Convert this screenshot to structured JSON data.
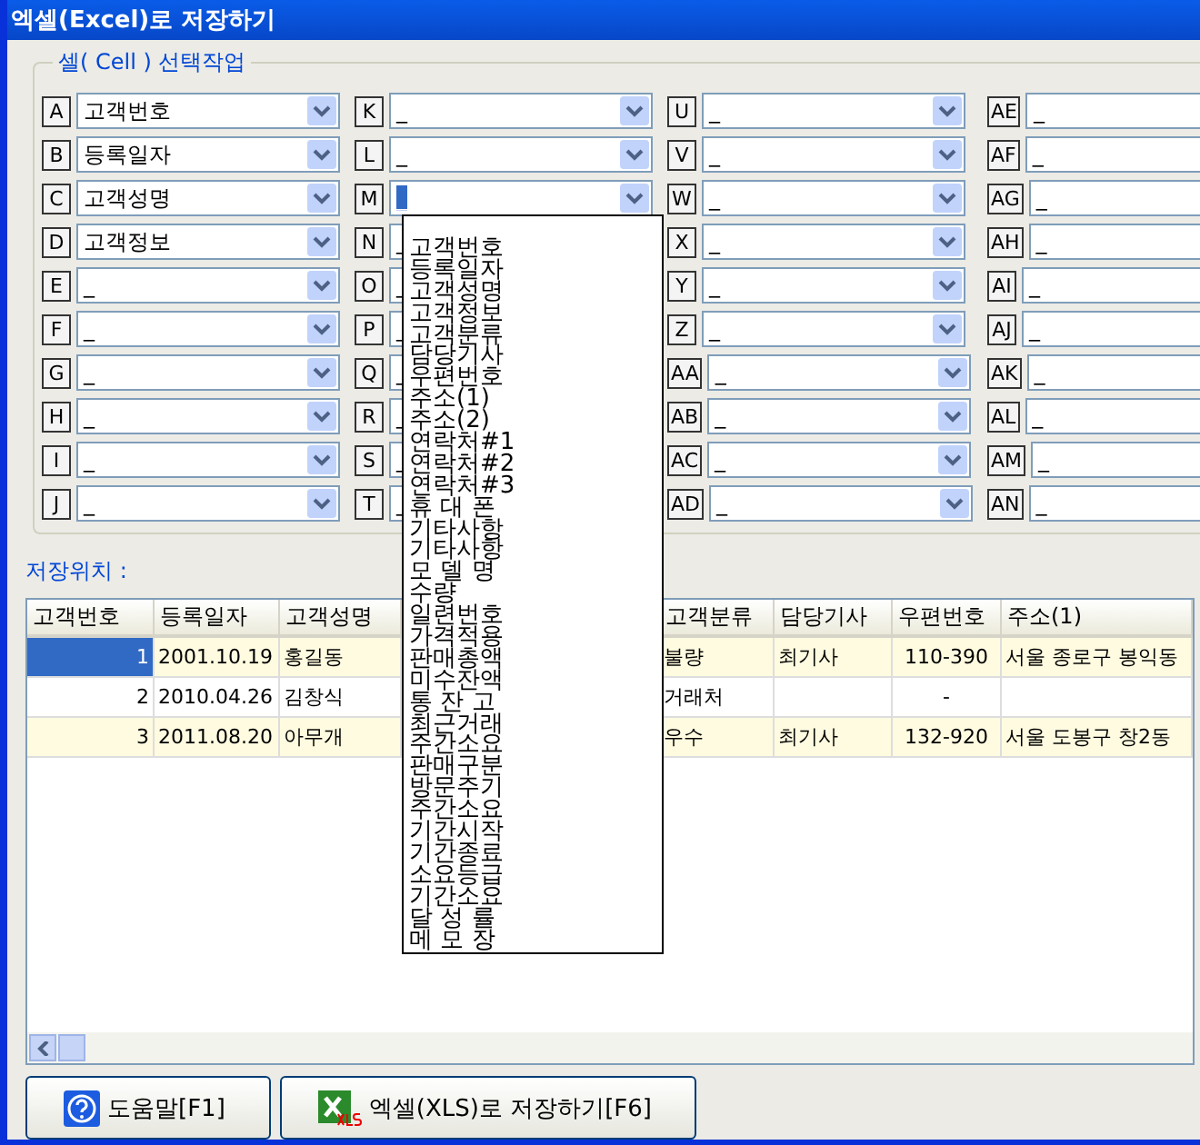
{
  "window": {
    "title": "엑셀(Excel)로 저장하기"
  },
  "cell_group": {
    "title": "셀( Cell ) 선택작업",
    "cells": [
      {
        "letter": "A",
        "value": "고객번호",
        "selected": false
      },
      {
        "letter": "B",
        "value": "등록일자",
        "selected": false
      },
      {
        "letter": "C",
        "value": "고객성명",
        "selected": false
      },
      {
        "letter": "D",
        "value": "고객정보",
        "selected": false
      },
      {
        "letter": "E",
        "value": "_",
        "selected": false
      },
      {
        "letter": "F",
        "value": "_",
        "selected": false
      },
      {
        "letter": "G",
        "value": "_",
        "selected": false
      },
      {
        "letter": "H",
        "value": "_",
        "selected": false
      },
      {
        "letter": "I",
        "value": "_",
        "selected": false
      },
      {
        "letter": "J",
        "value": "_",
        "selected": false
      },
      {
        "letter": "K",
        "value": "_",
        "selected": false
      },
      {
        "letter": "L",
        "value": "_",
        "selected": false
      },
      {
        "letter": "M",
        "value": "_",
        "selected": true
      },
      {
        "letter": "N",
        "value": "_",
        "selected": false
      },
      {
        "letter": "O",
        "value": "_",
        "selected": false
      },
      {
        "letter": "P",
        "value": "_",
        "selected": false
      },
      {
        "letter": "Q",
        "value": "_",
        "selected": false
      },
      {
        "letter": "R",
        "value": "_",
        "selected": false
      },
      {
        "letter": "S",
        "value": "_",
        "selected": false
      },
      {
        "letter": "T",
        "value": "_",
        "selected": false
      },
      {
        "letter": "U",
        "value": "_",
        "selected": false
      },
      {
        "letter": "V",
        "value": "_",
        "selected": false
      },
      {
        "letter": "W",
        "value": "_",
        "selected": false
      },
      {
        "letter": "X",
        "value": "_",
        "selected": false
      },
      {
        "letter": "Y",
        "value": "_",
        "selected": false
      },
      {
        "letter": "Z",
        "value": "_",
        "selected": false
      },
      {
        "letter": "AA",
        "value": "_",
        "selected": false
      },
      {
        "letter": "AB",
        "value": "_",
        "selected": false
      },
      {
        "letter": "AC",
        "value": "_",
        "selected": false
      },
      {
        "letter": "AD",
        "value": "_",
        "selected": false
      },
      {
        "letter": "AE",
        "value": "_",
        "selected": false
      },
      {
        "letter": "AF",
        "value": "_",
        "selected": false
      },
      {
        "letter": "AG",
        "value": "_",
        "selected": false
      },
      {
        "letter": "AH",
        "value": "_",
        "selected": false
      },
      {
        "letter": "AI",
        "value": "_",
        "selected": false
      },
      {
        "letter": "AJ",
        "value": "_",
        "selected": false
      },
      {
        "letter": "AK",
        "value": "_",
        "selected": false
      },
      {
        "letter": "AL",
        "value": "_",
        "selected": false
      },
      {
        "letter": "AM",
        "value": "_",
        "selected": false
      },
      {
        "letter": "AN",
        "value": "_",
        "selected": false
      }
    ]
  },
  "dropdown_list": {
    "items": [
      "고객번호",
      "등록일자",
      "고객성명",
      "고객정보",
      "고객분류",
      "담당기사",
      "우편번호",
      "주소(1)",
      "주소(2)",
      "연락처#1",
      "연락처#2",
      "연락처#3",
      "휴 대 폰",
      "기타사항",
      "기타사항",
      "모 델 명",
      "수량",
      "일련번호",
      "가격적용",
      "판매총액",
      "미수잔액",
      "통 잔 고",
      "최근거래",
      "주간소요",
      "판매구분",
      "방문주기",
      "주간소요",
      "기간시작",
      "기간종료",
      "소요등급",
      "기간소요",
      "달 성 률",
      "메 모 장"
    ]
  },
  "save_location": {
    "label": "저장위치 :"
  },
  "table": {
    "columns": [
      "고객번호",
      "등록일자",
      "고객성명",
      "",
      "고객분류",
      "담당기사",
      "우편번호",
      "주소(1)"
    ],
    "rows": [
      {
        "selected": true,
        "cells": [
          "1",
          "2001.10.19",
          "홍길동",
          "",
          "불량",
          "최기사",
          "110-390",
          "서울 종로구 봉익동"
        ]
      },
      {
        "selected": false,
        "cells": [
          "2",
          "2010.04.26",
          "김창식",
          "",
          "거래처",
          "",
          "-",
          ""
        ]
      },
      {
        "selected": false,
        "cells": [
          "3",
          "2011.08.20",
          "아무개",
          "",
          "우수",
          "최기사",
          "132-920",
          "서울 도봉구 창2동"
        ]
      }
    ]
  },
  "buttons": [
    {
      "kind": "help",
      "label": "도움말[F1]"
    },
    {
      "kind": "excel",
      "label": "엑셀(XLS)로 저장하기[F6]"
    }
  ]
}
